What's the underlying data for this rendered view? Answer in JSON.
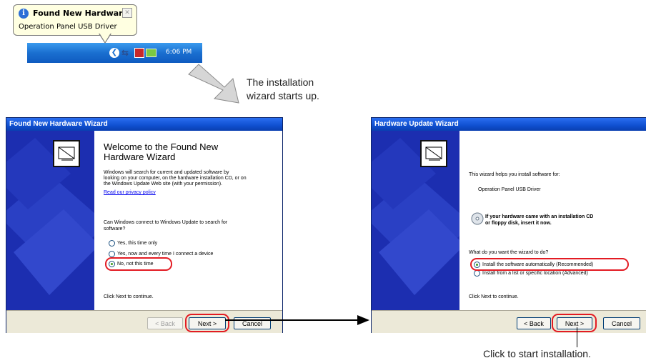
{
  "balloon": {
    "title": "Found New Hardware",
    "text": "Operation Panel USB Driver",
    "close_glyph": "✕"
  },
  "tray": {
    "chevron_glyph": "❮",
    "usb_glyph": "⇆",
    "clock": "6:06 PM"
  },
  "captions": {
    "wizard_start_line1": "The installation",
    "wizard_start_line2": "wizard starts up.",
    "click_start": "Click to start installation."
  },
  "wizard1": {
    "title": "Found New Hardware Wizard",
    "heading_line1": "Welcome to the Found New",
    "heading_line2": "Hardware Wizard",
    "intro_line1": "Windows will search for current and updated software by",
    "intro_line2": "looking on your computer, on the hardware installation CD, or on",
    "intro_line3": "the Windows Update Web site (with your permission).",
    "privacy_link": "Read our privacy policy",
    "question_line1": "Can Windows connect to Windows Update to search for",
    "question_line2": "software?",
    "options": [
      {
        "label": "Yes, this time only",
        "selected": false
      },
      {
        "label": "Yes, now and every time I connect a device",
        "selected": false
      },
      {
        "label": "No, not this time",
        "selected": true
      }
    ],
    "footer": "Click Next to continue.",
    "buttons": {
      "back": "< Back",
      "next": "Next >",
      "cancel": "Cancel"
    }
  },
  "wizard2": {
    "title": "Hardware Update Wizard",
    "intro": "This wizard helps you install software for:",
    "device": "Operation Panel USB Driver",
    "cd_note_line1": "If your hardware came with an installation CD",
    "cd_note_line2": "or floppy disk, insert it now.",
    "question": "What do you want the wizard to do?",
    "options": [
      {
        "label": "Install the software automatically (Recommended)",
        "selected": true
      },
      {
        "label": "Install from a list or specific location (Advanced)",
        "selected": false
      }
    ],
    "footer": "Click Next to continue.",
    "buttons": {
      "back": "< Back",
      "next": "Next >",
      "cancel": "Cancel"
    }
  },
  "colors": {
    "highlight": "#e31b23",
    "xp_title_blue": "#0f4fd0",
    "wizard_sidebar": "#1c2eb0"
  }
}
